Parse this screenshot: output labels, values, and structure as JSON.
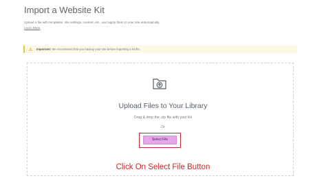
{
  "header": {
    "title": "Import a Website Kit",
    "description": "Upload a file with templates, site settings, content, etc., and apply them to your site automatically.",
    "learn_more": "Learn More"
  },
  "notice": {
    "icon": "warning-icon",
    "label": "Important:",
    "text": "We recommend that you backup your site before importing a kit file."
  },
  "upload": {
    "icon": "folder-upload-icon",
    "title": "Upload Files to Your Library",
    "subtitle": "Drag & drop the .zip file with your Kit",
    "or": "Or",
    "button_label": "Select File"
  },
  "annotation": {
    "caption": "Click On Select File Button",
    "highlight_color": "#c52c37"
  },
  "colors": {
    "accent_button": "#e7a6ea",
    "notice_bg": "#fcf8e6",
    "notice_border": "#f0c33c",
    "caption": "#c62828"
  }
}
